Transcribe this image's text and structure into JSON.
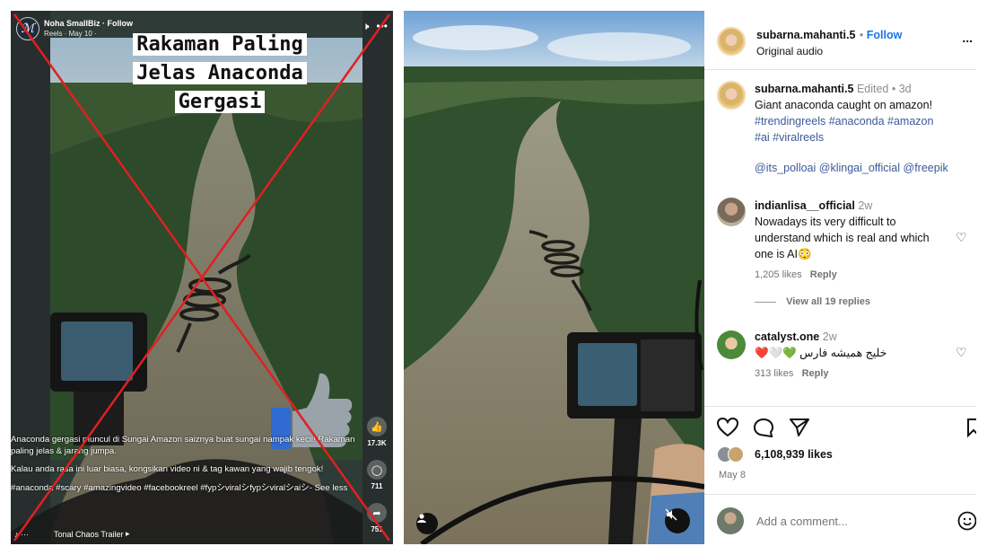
{
  "facebook_reel": {
    "page_name": "Noha SmallBiz",
    "follow_label": "Follow",
    "meta": "Reels · May 10 ·",
    "title_lines": [
      "Rakaman Paling",
      "Jelas Anaconda",
      "Gergasi"
    ],
    "like_count": "17.3K",
    "comment_count": "711",
    "share_count": "751",
    "caption_1": "Anaconda gergasi muncul di Sungai Amazon saiznya buat sungai nampak kecil! Rakaman paling jelas & jarang jumpa.",
    "caption_2": "Kalau anda rasa ini luar biasa, kongsikan video ni & tag kawan yang wajib tengok!",
    "caption_3": "#anaconda #scary #amazingvideo #facebookreel #fypシviralシfypシviralシaiシ- See less",
    "audio_label": "Tonal Chaos Trailer",
    "colors": {
      "cross_red": "#e02020",
      "thumb_blue": "#2f6bd0"
    }
  },
  "instagram": {
    "header": {
      "username": "subarna.mahanti.5",
      "follow": "Follow",
      "audio": "Original audio",
      "more": "..."
    },
    "caption": {
      "username": "subarna.mahanti.5",
      "edited": "Edited",
      "time": "3d",
      "text": "Giant anaconda caught on amazon!",
      "hashtags_1": "#trendingreels #anaconda #amazon",
      "hashtags_2": "#ai #viralreels",
      "mentions": "@its_polloai @klingai_official @freepik"
    },
    "comments": [
      {
        "username": "indianlisa__official",
        "time": "2w",
        "text_1": "Nowadays its very difficult to",
        "text_2": "understand which is real and which",
        "text_3": "one is AI😳",
        "likes": "1,205 likes",
        "reply": "Reply",
        "view_replies": "View all 19 replies"
      },
      {
        "username": "catalyst.one",
        "time": "2w",
        "text": "خلیج همیشه فارس 💚🤍❤️",
        "likes": "313 likes",
        "reply": "Reply"
      }
    ],
    "likes_count": "6,108,939 likes",
    "date": "May 8",
    "add_comment_placeholder": "Add a comment..."
  }
}
